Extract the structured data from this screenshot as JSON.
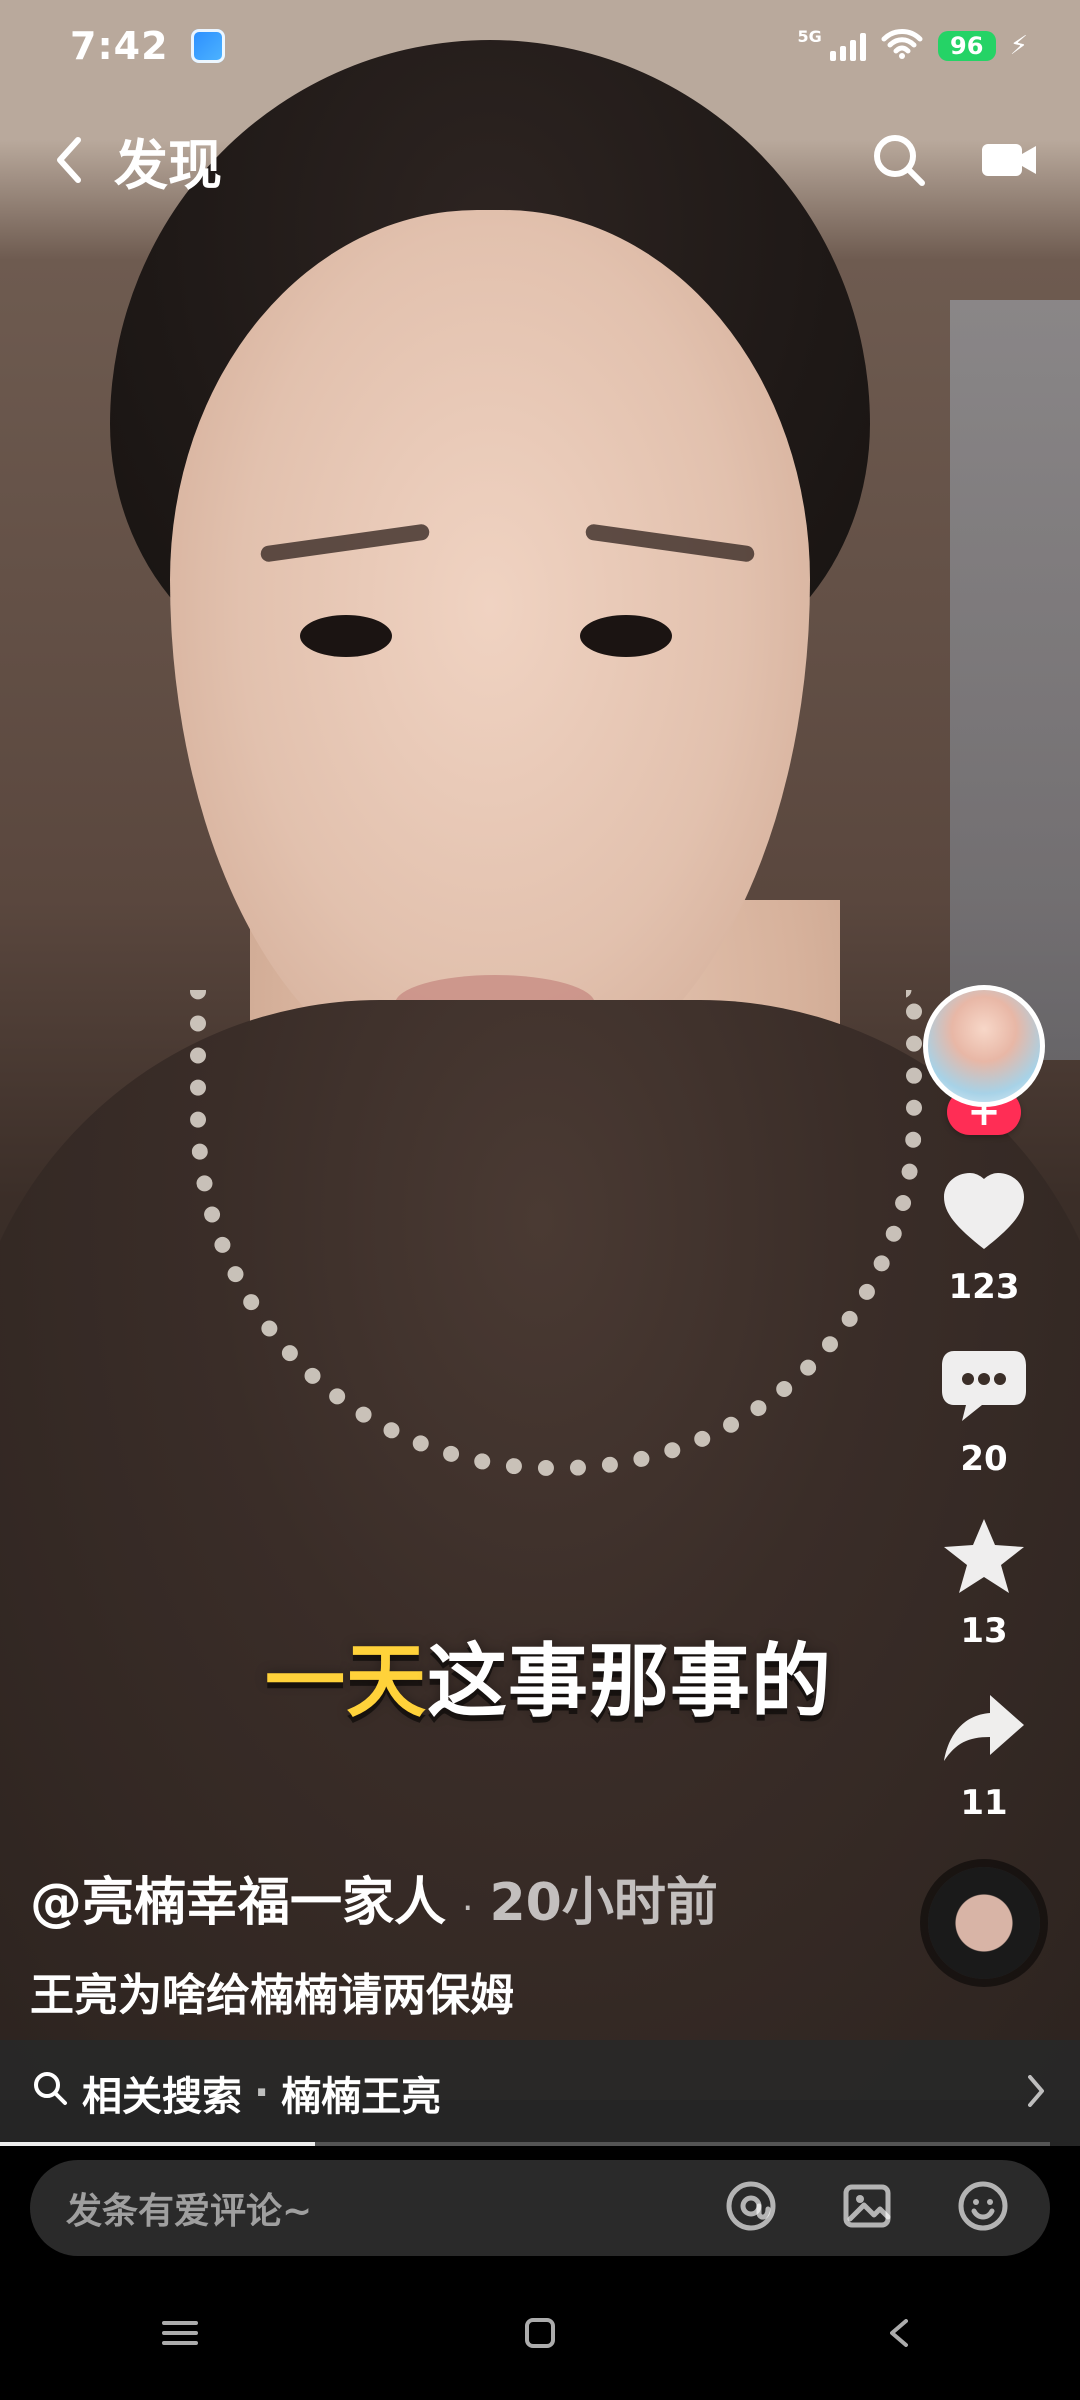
{
  "status_bar": {
    "time": "7:42",
    "network": "5G",
    "battery": "96",
    "colors": {
      "battery_bg": "#25d366"
    }
  },
  "header": {
    "back_icon": "chevron-left-icon",
    "title": "发现",
    "search_icon": "search-icon",
    "video_icon": "video-camera-icon"
  },
  "overlay": {
    "subtitle": {
      "highlight": "一天",
      "rest": "这事那事的"
    },
    "author": "@亮楠幸福一家人",
    "time_ago": "20小时前",
    "caption": "王亮为啥给楠楠请两保姆"
  },
  "right_rail": {
    "follow_plus": "+",
    "likes": "123",
    "comments": "20",
    "favorites": "13",
    "shares": "11"
  },
  "related_search": {
    "label": "相关搜索",
    "separator": "·",
    "query": "楠楠王亮",
    "progress": 0.3
  },
  "comment_input": {
    "placeholder": "发条有爱评论~"
  },
  "system_nav": {
    "buttons": [
      "menu",
      "home",
      "back"
    ]
  }
}
